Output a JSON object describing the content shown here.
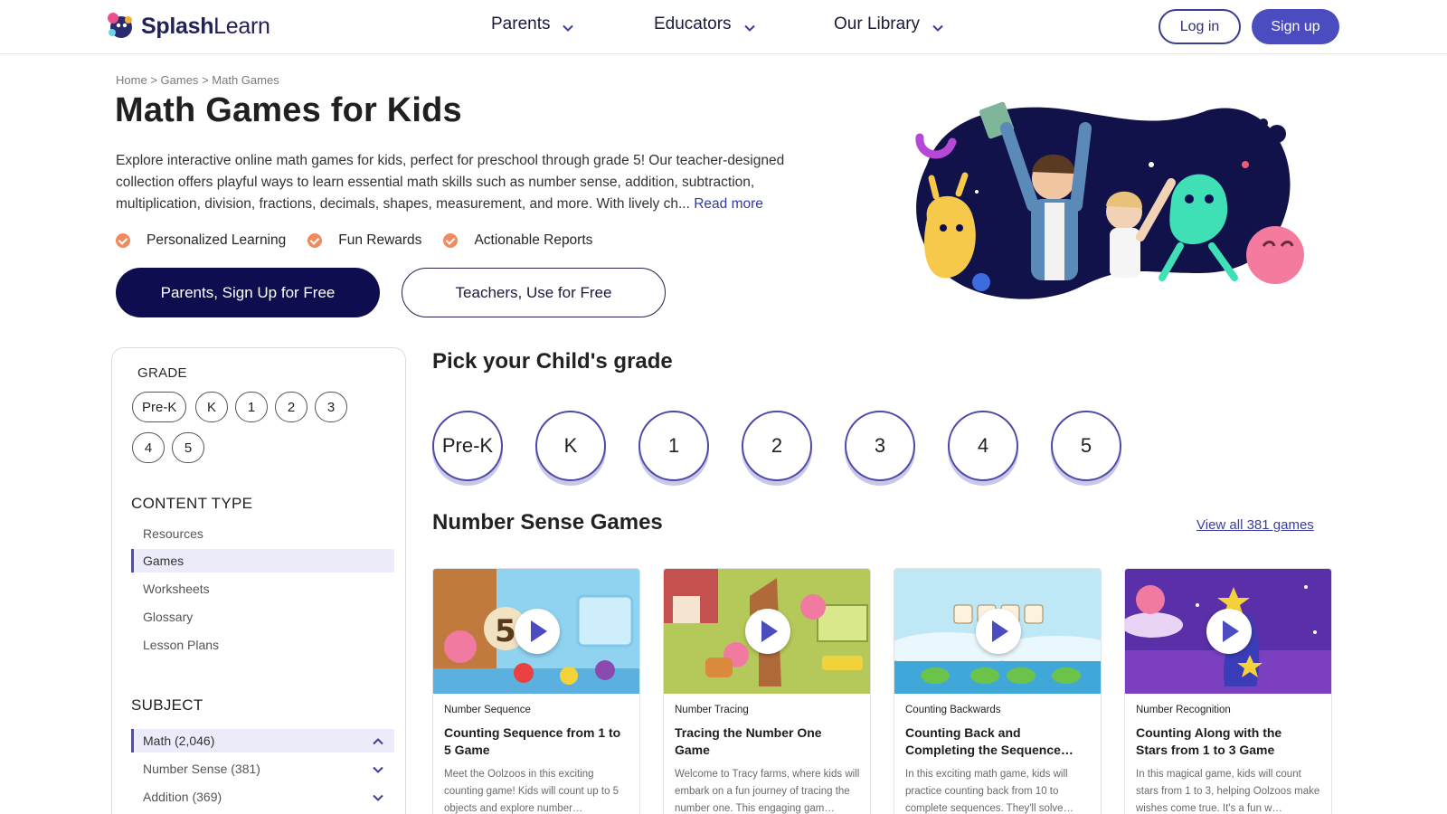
{
  "header": {
    "logo": {
      "part1": "Splash",
      "part2": "Learn"
    },
    "nav": [
      "Parents",
      "Educators",
      "Our Library"
    ],
    "login_label": "Log in",
    "signup_label": "Sign up"
  },
  "hero": {
    "breadcrumb": [
      "Home",
      "Games",
      "Math Games"
    ],
    "title": "Math Games for Kids",
    "intro": "Explore interactive online math games for kids, perfect for preschool through grade 5! Our teacher-designed collection offers playful ways to learn essential math skills such as number sense, addition, subtraction, multiplication, division, fractions, decimals, shapes, measurement, and more. With lively ch...",
    "read_more": " Read more",
    "features": [
      "Personalized Learning",
      "Fun Rewards",
      "Actionable Reports"
    ],
    "parents_cta": "Parents, Sign Up for Free",
    "teachers_cta": "Teachers, Use for Free"
  },
  "sidebar": {
    "grade_heading": "GRADE",
    "grades": [
      "Pre-K",
      "K",
      "1",
      "2",
      "3",
      "4",
      "5"
    ],
    "content_type_heading": "CONTENT TYPE",
    "content_types": [
      "Resources",
      "Games",
      "Worksheets",
      "Glossary",
      "Lesson Plans"
    ],
    "active_content_type": "Games",
    "subject_heading": "SUBJECT",
    "subjects": [
      "Math (2,046)",
      "Number Sense (381)",
      "Addition (369)"
    ]
  },
  "grade_picker": {
    "title": "Pick your Child's grade",
    "grades": [
      "Pre-K",
      "K",
      "1",
      "2",
      "3",
      "4",
      "5"
    ]
  },
  "games_section": {
    "title": "Number Sense Games",
    "view_all": "View all 381 games",
    "cards": [
      {
        "category": "Number Sequence",
        "title": "Counting Sequence from 1 to 5 Game",
        "description": "Meet the Oolzoos in this exciting counting game! Kids will count up to 5 objects and explore number…"
      },
      {
        "category": "Number Tracing",
        "title": "Tracing the Number One Game",
        "description": "Welcome to Tracy farms, where kids will embark on a fun journey of tracing the number one. This engaging gam…"
      },
      {
        "category": "Counting Backwards",
        "title": "Counting Back and Completing the Sequence…",
        "description": "In this exciting math game, kids will practice counting back from 10 to complete sequences. They'll solve…"
      },
      {
        "category": "Number Recognition",
        "title": "Counting Along with the Stars from 1 to 3 Game",
        "description": "In this magical game, kids will count stars from 1 to 3, helping Oolzoos make wishes come true. It's a fun w…"
      }
    ]
  },
  "colors": {
    "brand_navy": "#0d0d4f",
    "accent_purple": "#4b4cbf",
    "check_orange": "#f08b5e",
    "link_blue": "#2f3aa6"
  },
  "icons": [
    "chevron-down-icon",
    "chevron-up-icon",
    "check-icon",
    "play-icon"
  ]
}
